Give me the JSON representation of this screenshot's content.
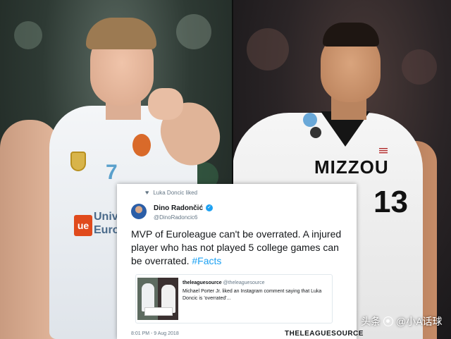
{
  "left_photo": {
    "jersey_number": "7",
    "sponsor_mark": "ue",
    "sponsor_text": "Univ Euro"
  },
  "right_photo": {
    "jersey_wordmark": "MIZZOU",
    "jersey_number": "13"
  },
  "tweet": {
    "liked_by": "Luka Doncic liked",
    "author_name": "Dino Radončić",
    "author_handle": "@DinoRadoncic6",
    "body_text": "MVP of Euroleague can't be overrated. A injured player who has not played 5 college games can be overrated.",
    "hashtag": "#Facts",
    "quoted": {
      "name": "theleaguesource",
      "handle": "@theleaguesource",
      "text": "Michael Porter Jr. liked an Instagram comment saying that Luka Doncic is 'overrated'..."
    },
    "timestamp": "8:01 PM - 9 Aug 2018",
    "brand": "THELEAGUESOURCE"
  },
  "watermark": {
    "platform": "头条",
    "account": "@小A话球"
  },
  "colors": {
    "link_blue": "#1da1f2",
    "secondary_text": "#657786",
    "real_madrid_blue": "#5aa0cc"
  },
  "icons": [
    "heart-icon",
    "verified-badge-icon",
    "camera-icon"
  ]
}
